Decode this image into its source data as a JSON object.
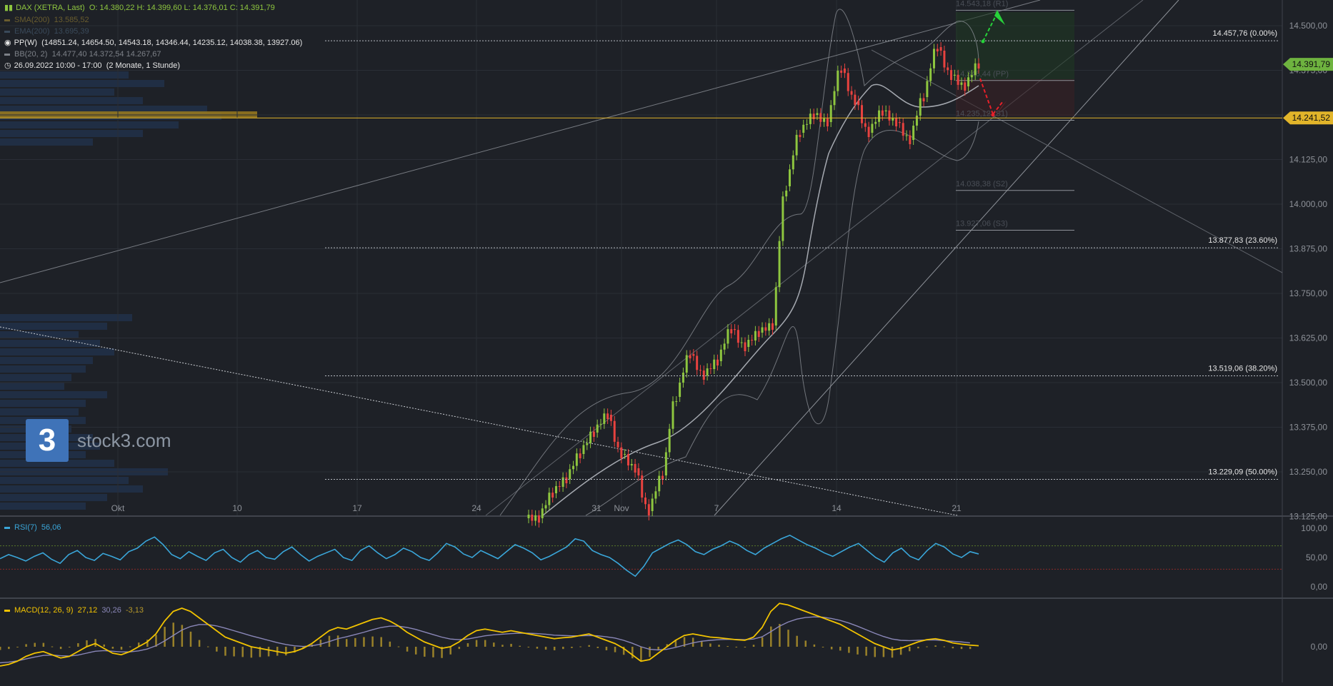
{
  "legend": {
    "instrument": "DAX (XETRA, Last)",
    "ohlc": "O: 14.380,22  H: 14.399,60  L: 14.376,01  C: 14.391,79",
    "sma_label": "SMA(200)",
    "sma_value": "13.585,52",
    "ema_label": "EMA(200)",
    "ema_value": "13.695,39",
    "pp_label": "PP(W)",
    "pp_values": "(14851.24, 14654.50, 14543.18, 14346.44, 14235.12, 14038.38, 13927.06)",
    "bb_label": "BB(20, 2)",
    "bb_values": "14.477,40  14.372,54  14.267,67",
    "range": "26.09.2022 10:00 - 17:00",
    "range_note": "(2 Monate, 1 Stunde)"
  },
  "colors": {
    "background": "#1e2127",
    "up": "#8ec63f",
    "down": "#e8423f",
    "rsi": "#3aa6d9",
    "macd": "#f2c300",
    "signal": "#8a87b8",
    "gold": "#e2b52a",
    "price_badge": "#6eb33f"
  },
  "logo": {
    "mark": "3",
    "name": "stock3.com"
  },
  "chart_data": [
    {
      "type": "candlestick",
      "name": "DAX (XETRA, Last)",
      "ylim": [
        13125,
        14540
      ],
      "yticks": [
        "14.500,00",
        "14.375,00",
        "14.250,00",
        "14.125,00",
        "14.000,00",
        "13.875,00",
        "13.750,00",
        "13.625,00",
        "13.500,00",
        "13.375,00",
        "13.250,00",
        "13.125,00"
      ],
      "xticks": [
        "Okt",
        "10",
        "17",
        "24",
        "31",
        "Nov",
        "7",
        "14",
        "21"
      ],
      "last_price": "14.391,79",
      "marked_price": "14.241,52",
      "fib_levels": [
        {
          "label": "14.457,76 (0.00%)",
          "value": 14457.76
        },
        {
          "label": "13.877,83 (23.60%)",
          "value": 13877.83
        },
        {
          "label": "13.519,06 (38.20%)",
          "value": 13519.06
        },
        {
          "label": "13.229,09 (50.00%)",
          "value": 13229.09
        }
      ],
      "pivots": [
        {
          "label": "14.543,18 (R1)",
          "value": 14543.18
        },
        {
          "label": "14.346,44 (PP)",
          "value": 14346.44
        },
        {
          "label": "14.235,12 (S1)",
          "value": 14235.12
        },
        {
          "label": "14.038,38 (S2)",
          "value": 14038.38
        },
        {
          "label": "13.927,06 (S3)",
          "value": 13927.06
        }
      ],
      "bollinger": {
        "upper": "14.477,40",
        "middle": "14.372,54",
        "lower": "14.267,67"
      },
      "series_close": [
        {
          "x": "31.10. 09",
          "y": 13120
        },
        {
          "x": "31.10. 13",
          "y": 13190
        },
        {
          "x": "31.10. 17",
          "y": 13230
        },
        {
          "x": "01.11. 11",
          "y": 13300
        },
        {
          "x": "02.11. 09",
          "y": 13360
        },
        {
          "x": "02.11. 15",
          "y": 13410
        },
        {
          "x": "03.11. 11",
          "y": 13300
        },
        {
          "x": "03.11. 17",
          "y": 13260
        },
        {
          "x": "04.11. 13",
          "y": 13140
        },
        {
          "x": "07.11. 09",
          "y": 13240
        },
        {
          "x": "07.11. 15",
          "y": 13460
        },
        {
          "x": "08.11. 11",
          "y": 13580
        },
        {
          "x": "08.11. 17",
          "y": 13520
        },
        {
          "x": "09.11. 13",
          "y": 13560
        },
        {
          "x": "09.11. 17",
          "y": 13650
        },
        {
          "x": "10.11. 11",
          "y": 13600
        },
        {
          "x": "10.11. 15",
          "y": 13640
        },
        {
          "x": "10.11. 17",
          "y": 13660
        },
        {
          "x": "11.11. 09",
          "y": 14050
        },
        {
          "x": "11.11. 15",
          "y": 14200
        },
        {
          "x": "14.11. 11",
          "y": 14250
        },
        {
          "x": "14.11. 17",
          "y": 14230
        },
        {
          "x": "15.11. 13",
          "y": 14380
        },
        {
          "x": "16.11. 11",
          "y": 14290
        },
        {
          "x": "17.11. 09",
          "y": 14200
        },
        {
          "x": "17.11. 15",
          "y": 14260
        },
        {
          "x": "18.11. 11",
          "y": 14230
        },
        {
          "x": "18.11. 15",
          "y": 14180
        },
        {
          "x": "21.11. 09",
          "y": 14300
        },
        {
          "x": "21.11. 13",
          "y": 14440
        },
        {
          "x": "22.11. 09",
          "y": 14360
        },
        {
          "x": "22.11. 15",
          "y": 14330
        },
        {
          "x": "23.11. 11",
          "y": 14392
        }
      ]
    },
    {
      "type": "line",
      "name": "RSI(7)",
      "value": "56,06",
      "ylim": [
        0,
        100
      ],
      "yticks": [
        "100,00",
        "50,00",
        "0,00"
      ],
      "y": [
        48,
        55,
        50,
        44,
        52,
        58,
        47,
        40,
        55,
        62,
        50,
        45,
        57,
        52,
        46,
        60,
        66,
        78,
        85,
        72,
        55,
        48,
        60,
        52,
        45,
        58,
        64,
        50,
        42,
        55,
        62,
        50,
        47,
        60,
        68,
        55,
        44,
        52,
        58,
        64,
        50,
        45,
        62,
        70,
        58,
        48,
        55,
        66,
        60,
        50,
        45,
        58,
        74,
        68,
        56,
        50,
        62,
        55,
        48,
        60,
        72,
        66,
        58,
        46,
        52,
        60,
        68,
        82,
        78,
        62,
        55,
        50,
        40,
        28,
        18,
        35,
        58,
        66,
        74,
        80,
        72,
        60,
        55,
        64,
        70,
        78,
        72,
        62,
        55,
        66,
        74,
        82,
        88,
        80,
        72,
        66,
        58,
        52,
        60,
        68,
        74,
        62,
        50,
        42,
        58,
        66,
        52,
        46,
        62,
        74,
        68,
        56,
        50,
        60,
        56
      ]
    },
    {
      "type": "line",
      "name": "MACD(12, 26, 9)",
      "values_text": "27,12",
      "signal_text": "30,26",
      "hist_text": "-3,13",
      "yticks": [
        "0,00"
      ],
      "macd": [
        -60,
        -55,
        -45,
        -30,
        -20,
        -15,
        -25,
        -35,
        -30,
        -15,
        0,
        10,
        -5,
        -20,
        -25,
        -15,
        0,
        15,
        40,
        80,
        110,
        120,
        110,
        90,
        70,
        50,
        30,
        20,
        10,
        0,
        -5,
        -10,
        -15,
        -20,
        -15,
        -5,
        10,
        30,
        50,
        60,
        55,
        65,
        75,
        85,
        90,
        80,
        65,
        45,
        30,
        15,
        5,
        -5,
        0,
        15,
        35,
        50,
        55,
        50,
        45,
        50,
        45,
        40,
        35,
        30,
        25,
        28,
        30,
        35,
        40,
        30,
        20,
        10,
        -5,
        -25,
        -45,
        -40,
        -20,
        0,
        20,
        35,
        40,
        35,
        30,
        28,
        25,
        22,
        20,
        30,
        60,
        110,
        135,
        130,
        120,
        110,
        100,
        90,
        80,
        70,
        55,
        40,
        25,
        10,
        0,
        -10,
        -5,
        5,
        15,
        22,
        25,
        20,
        12,
        8,
        5,
        3
      ],
      "signal": [
        -50,
        -48,
        -44,
        -38,
        -32,
        -27,
        -26,
        -28,
        -29,
        -26,
        -20,
        -14,
        -12,
        -14,
        -16,
        -16,
        -13,
        -7,
        3,
        18,
        35,
        52,
        63,
        69,
        69,
        65,
        58,
        50,
        42,
        34,
        27,
        20,
        13,
        7,
        3,
        1,
        3,
        8,
        16,
        25,
        31,
        38,
        45,
        53,
        60,
        64,
        64,
        60,
        54,
        46,
        38,
        30,
        24,
        22,
        24,
        29,
        34,
        37,
        39,
        41,
        42,
        42,
        41,
        39,
        36,
        35,
        34,
        34,
        35,
        34,
        31,
        27,
        20,
        11,
        0,
        -8,
        -10,
        -8,
        -2,
        5,
        12,
        17,
        20,
        22,
        23,
        23,
        22,
        24,
        31,
        47,
        64,
        77,
        86,
        91,
        93,
        92,
        88,
        82,
        74,
        64,
        53,
        42,
        32,
        24,
        20,
        19,
        20,
        21,
        21,
        19,
        17,
        15,
        12
      ]
    }
  ]
}
